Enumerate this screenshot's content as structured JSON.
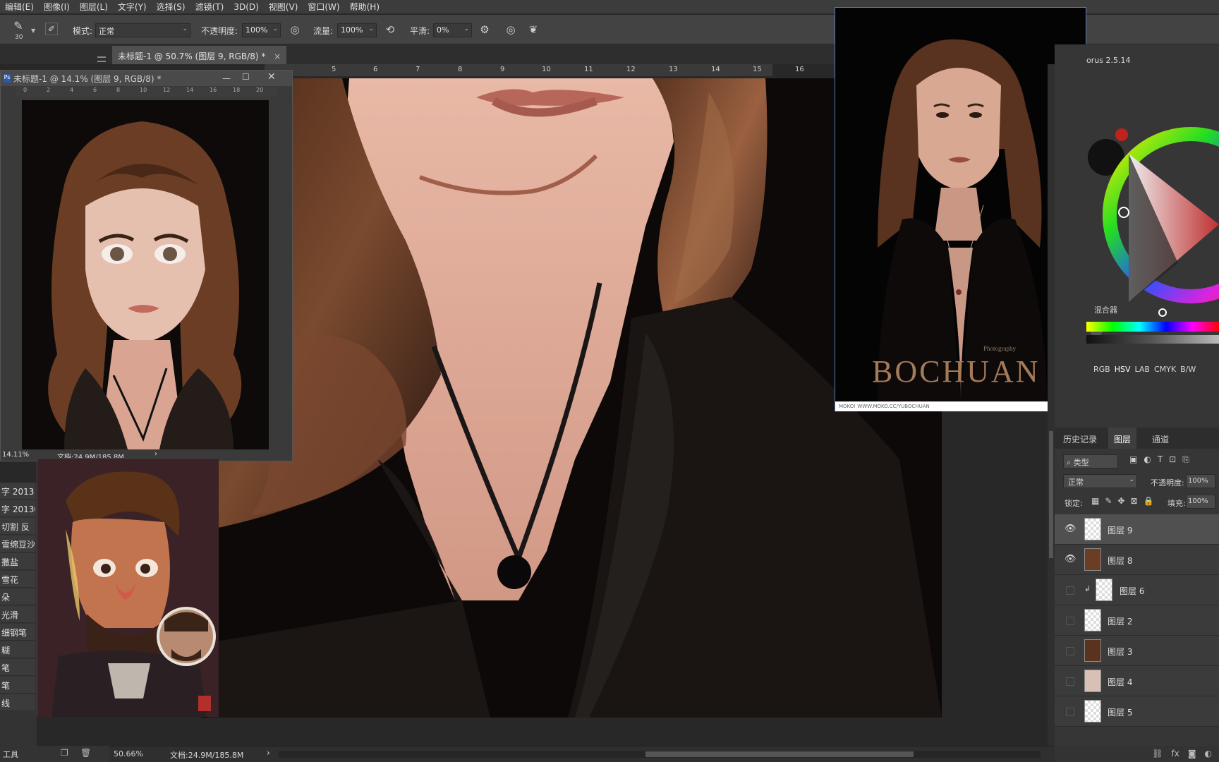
{
  "menu": [
    "编辑(E)",
    "图像(I)",
    "图层(L)",
    "文字(Y)",
    "选择(S)",
    "滤镜(T)",
    "3D(D)",
    "视图(V)",
    "窗口(W)",
    "帮助(H)"
  ],
  "options": {
    "brush_size": "30",
    "mode_label": "模式:",
    "mode_value": "正常",
    "opacity_label": "不透明度:",
    "opacity_value": "100%",
    "flow_label": "流量:",
    "flow_value": "100%",
    "smooth_label": "平滑:",
    "smooth_value": "0%"
  },
  "tabs": {
    "active_doc": "未标题-1 @ 50.7% (图层 9, RGB/8) *",
    "close": "×"
  },
  "ruler": [
    "5",
    "6",
    "7",
    "8",
    "9",
    "10",
    "11",
    "12",
    "13",
    "14",
    "15",
    "16"
  ],
  "preview": {
    "title": "未标题-1 @ 14.1% (图层 9, RGB/8) *",
    "ruler": [
      "0",
      "2",
      "4",
      "6",
      "8",
      "10",
      "12",
      "14",
      "16",
      "18",
      "20"
    ],
    "zoom": "14.11%",
    "doc": "文档:24.9M/185.8M"
  },
  "brush_list": [
    "字 2013",
    "字 20130",
    "切割 反",
    "雪绵豆沙",
    "撒盐",
    "雪花",
    "朵",
    "光滑",
    "细钢笔",
    "糊",
    "笔",
    "笔",
    "线"
  ],
  "bottom_left": {
    "tool": "工具"
  },
  "reference": {
    "brand": "BOCHUAN",
    "photography": "Photography",
    "footer": "MOKO! WWW.MOKO.CC/YUBOCHUAN"
  },
  "color_panel": {
    "title": "orus 2.5.14",
    "mixer": "混合器",
    "modes": [
      "RGB",
      "HSV",
      "LAB",
      "CMYK",
      "B/W"
    ]
  },
  "panel_tabs": [
    "历史记录",
    "图层",
    "通道"
  ],
  "layers_panel": {
    "filter_label": "类型",
    "blend": "正常",
    "opacity_label": "不透明度:",
    "opacity_value": "100%",
    "lock_label": "锁定:",
    "fill_label": "填充:",
    "fill_value": "100%",
    "layers": [
      {
        "name": "图层 9",
        "visible": true,
        "selected": true
      },
      {
        "name": "图层 8",
        "visible": true,
        "selected": false
      },
      {
        "name": "图层 6",
        "visible": false,
        "selected": false
      },
      {
        "name": "图层 2",
        "visible": false,
        "selected": false
      },
      {
        "name": "图层 3",
        "visible": false,
        "selected": false
      },
      {
        "name": "图层 4",
        "visible": false,
        "selected": false
      },
      {
        "name": "图层 5",
        "visible": false,
        "selected": false
      }
    ]
  },
  "status": {
    "zoom": "50.66%",
    "doc": "文档:24.9M/185.8M"
  },
  "colors": {
    "accent": "#5a7cb0",
    "hair": "#6a3b22",
    "skin": "#d9a48f",
    "background": "#0b0807"
  }
}
